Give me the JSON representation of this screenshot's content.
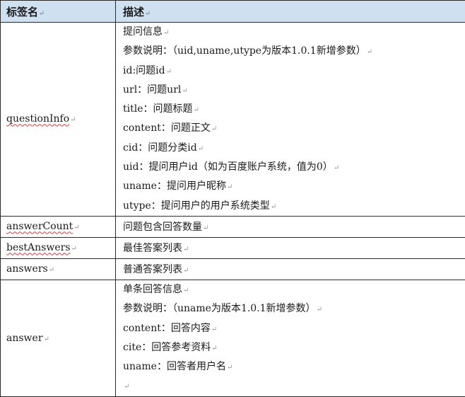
{
  "header": {
    "tag": "标签名",
    "desc": "描述"
  },
  "para_mark": "↵",
  "rows": [
    {
      "tag": "questionInfo",
      "lines": [
        "提问信息",
        "参数说明：（uid,uname,utype为版本1.0.1新增参数）",
        "id:问题id",
        "url：问题url",
        "title：问题标题",
        "content：问题正文",
        "cid：问题分类id",
        "uid：提问用户id（如为百度账户系统，值为0）",
        "uname：提问用户昵称",
        "utype：提问用户的用户系统类型"
      ]
    },
    {
      "tag": "answerCount",
      "lines": [
        "问题包含回答数量"
      ]
    },
    {
      "tag": "bestAnswers",
      "lines": [
        "最佳答案列表"
      ]
    },
    {
      "tag": "answers",
      "lines": [
        "普通答案列表"
      ]
    },
    {
      "tag": "answer",
      "lines": [
        "单条回答信息",
        "参数说明：（uname为版本1.0.1新增参数）",
        "content：回答内容",
        "cite：回答参考资料",
        "uname：回答者用户名",
        ""
      ]
    }
  ]
}
